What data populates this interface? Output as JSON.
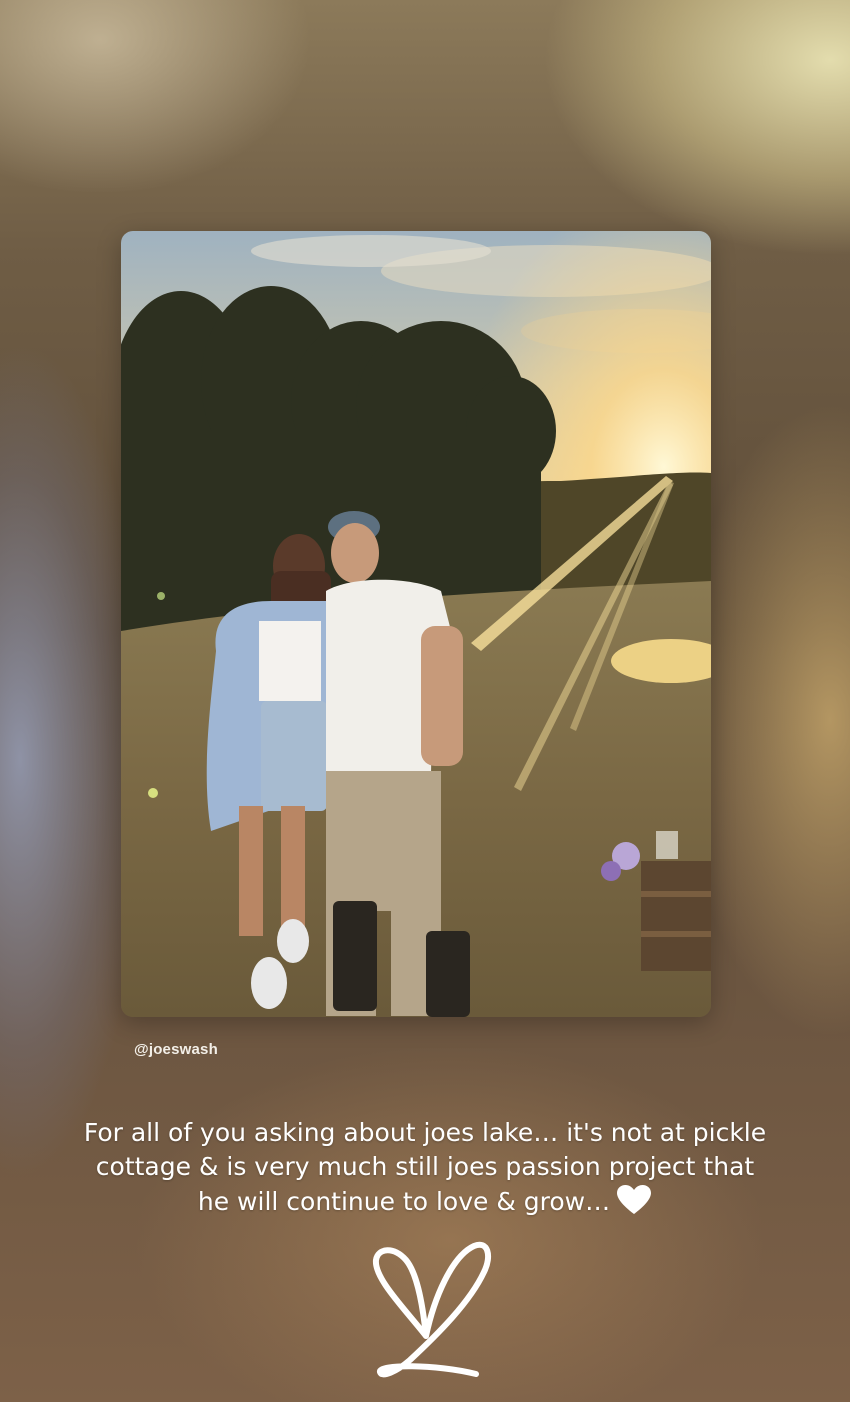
{
  "story": {
    "mention": "@joeswash",
    "caption_lines": [
      "For all of you asking about joes lake… it's not at pickle",
      "cottage & is very much still joes passion project that",
      "he will continue to love & grow…"
    ]
  },
  "photo": {
    "description_icon": "sunset-couple-photo"
  },
  "icons": {
    "inline_heart": "white-heart-icon",
    "sticker": "outline-heart-sticker"
  },
  "colors": {
    "text": "#ffffff",
    "sun": "#ffe7a0"
  }
}
